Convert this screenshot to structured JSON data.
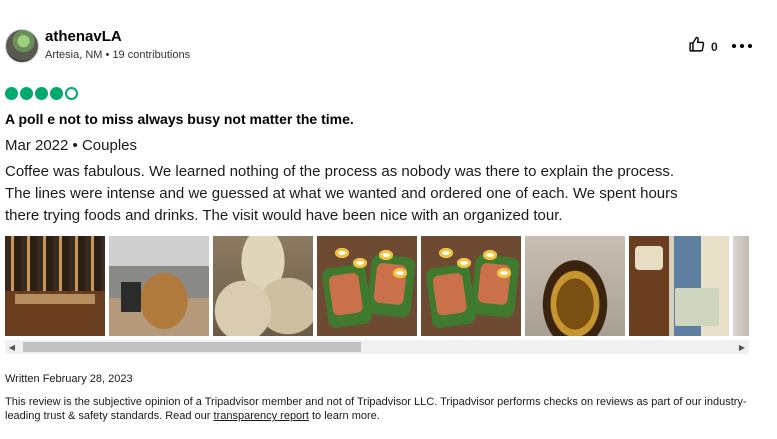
{
  "reviewer": {
    "username": "athenavLA",
    "location": "Artesia, NM",
    "contributions": "19 contributions",
    "meta_separator": " • "
  },
  "actions": {
    "helpful_count": "0",
    "helpful_icon": "thumbs-up-icon",
    "more_icon": "more-options-icon"
  },
  "review": {
    "rating": 4,
    "rating_max": 5,
    "rating_color": "#00aa6c",
    "title": "A poll e not to miss always busy not matter the time.",
    "date_trip": "Mar 2022 • Couples",
    "body_lines": [
      "Coffee was fabulous. We learned nothing of the process as nobody was there to explain the process.",
      "The lines were intense and we guessed at what we wanted and ordered one of each. We spent hours",
      "there trying foods and drinks. The visit would have been nice with an organized tour."
    ]
  },
  "photos": {
    "count_visible": 8
  },
  "footer": {
    "written": "Written February 28, 2023",
    "disclaimer_before": "This review is the subjective opinion of a Tripadvisor member and not of Tripadvisor LLC. Tripadvisor performs checks on reviews as part of our industry-leading trust & safety standards. Read our ",
    "link_text": "transparency report",
    "disclaimer_after": " to learn more."
  }
}
